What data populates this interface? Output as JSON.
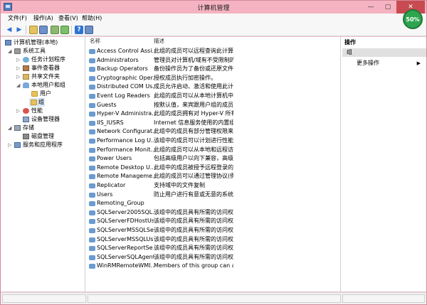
{
  "window": {
    "title": "计算机管理",
    "close_label": "✕",
    "minimize_label": "—",
    "maximize_label": "▢"
  },
  "badge": {
    "text": "50%"
  },
  "menubar": {
    "items": [
      "文件(F)",
      "操作(A)",
      "查看(V)",
      "帮助(H)"
    ]
  },
  "tree": {
    "items": [
      {
        "label": "计算机管理(本地)",
        "icon": "computer-icon"
      },
      {
        "label": "系统工具",
        "icon": "tool-icon"
      },
      {
        "label": "任务计划程序",
        "icon": "clock-icon"
      },
      {
        "label": "事件查看器",
        "icon": "book-icon"
      },
      {
        "label": "共享文件夹",
        "icon": "share-icon"
      },
      {
        "label": "本地用户和组",
        "icon": "user-icon"
      },
      {
        "label": "用户",
        "icon": "folder-icon"
      },
      {
        "label": "组",
        "icon": "folder-icon"
      },
      {
        "label": "性能",
        "icon": "perf-icon"
      },
      {
        "label": "设备管理器",
        "icon": "dev-icon"
      },
      {
        "label": "存储",
        "icon": "storage-icon"
      },
      {
        "label": "磁盘管理",
        "icon": "disk-icon"
      },
      {
        "label": "服务和应用程序",
        "icon": "service-icon"
      }
    ]
  },
  "list": {
    "headers": {
      "name": "名称",
      "desc": "描述"
    },
    "rows": [
      {
        "name": "Access Control Assi...",
        "desc": "此组的成员可以远程查询此计算..."
      },
      {
        "name": "Administrators",
        "desc": "管理员对计算机/域有不受限制的..."
      },
      {
        "name": "Backup Operators",
        "desc": "备份操作员为了备份或还原文件..."
      },
      {
        "name": "Cryptographic Oper...",
        "desc": "授权成员执行加密操作。"
      },
      {
        "name": "Distributed COM Us...",
        "desc": "成员允许启动、激活和使用此计..."
      },
      {
        "name": "Event Log Readers",
        "desc": "此组的成员可以从本地计算机中..."
      },
      {
        "name": "Guests",
        "desc": "按默认值，来宾跟用户组的成员..."
      },
      {
        "name": "Hyper-V Administra...",
        "desc": "此组的成员拥有对 Hyper-V 所有..."
      },
      {
        "name": "IIS_IUSRS",
        "desc": "Internet 信息服务使用的内置组。"
      },
      {
        "name": "Network Configurat...",
        "desc": "此组中的成员有部分管理权限来..."
      },
      {
        "name": "Performance Log U...",
        "desc": "该组中的成员可以计划进行性能..."
      },
      {
        "name": "Performance Monit...",
        "desc": "此组的成员可以从本地和远程访..."
      },
      {
        "name": "Power Users",
        "desc": "包括高级用户以向下兼容，高级..."
      },
      {
        "name": "Remote Desktop U...",
        "desc": "此组中的成员被授予远程登录的..."
      },
      {
        "name": "Remote Manageme...",
        "desc": "此组的成员可以通过管理协议(例..."
      },
      {
        "name": "Replicator",
        "desc": "支持域中的文件复制"
      },
      {
        "name": "Users",
        "desc": "防止用户进行有意或无意的系统..."
      },
      {
        "name": "Remoting_Group",
        "desc": ""
      },
      {
        "name": "SQLServer2005SQL...",
        "desc": "该组中的成员具有所需的访问权..."
      },
      {
        "name": "SQLServerFDHostUs...",
        "desc": "该组中的成员具有所需的访问权..."
      },
      {
        "name": "SQLServerMSSQLSe...",
        "desc": "该组中的成员具有所需的访问权..."
      },
      {
        "name": "SQLServerMSSQLUs...",
        "desc": "该组中的成员具有所需的访问权..."
      },
      {
        "name": "SQLServerReportSe...",
        "desc": "该组中的成员具有所需的访问权..."
      },
      {
        "name": "SQLServerSQLAgent...",
        "desc": "该组中的成员具有所需的访问权..."
      },
      {
        "name": "WinRMRemoteWMI...",
        "desc": "Members of this group can ac..."
      }
    ]
  },
  "actions": {
    "header": "操作",
    "group": "组",
    "more": "更多操作",
    "more_arrow": "▶"
  },
  "toolbar": {
    "back": "◀",
    "forward": "▶",
    "help": "?"
  }
}
